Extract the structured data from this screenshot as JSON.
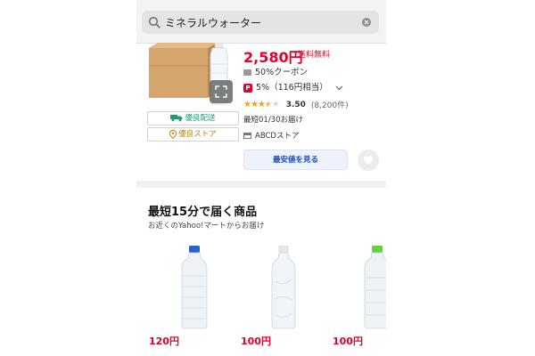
{
  "search": {
    "query": "ミネラルウォーター"
  },
  "product": {
    "price": "2,580円",
    "shipping_note": "送料無料",
    "coupon": "50%クーポン",
    "points": "5%（116円相当）",
    "rating_value": "3.50",
    "review_count": "(8,200件)",
    "rating_stars": 3.5,
    "delivery": "最短01/30お届け",
    "store_name": "ABCDストア",
    "badges": [
      "優良配送",
      "優良ストア"
    ],
    "cheapest_button": "最安値を見る"
  },
  "quick_section": {
    "title": "最短15分で届く商品",
    "subtitle": "お近くのYahoo!マートからお届け",
    "items": [
      {
        "price": "120円",
        "cap_color": "#2a62c9"
      },
      {
        "price": "100円",
        "cap_color": "#e6e6e6"
      },
      {
        "price": "100円",
        "cap_color": "#6ccf3a"
      }
    ]
  },
  "colors": {
    "accent_red": "#e4002b",
    "link_blue": "#1a4bbf",
    "green_badge": "#17a36a",
    "gold_badge": "#b8860b",
    "star": "#f0a020"
  },
  "icons": [
    "search-icon",
    "clear-icon",
    "expand-icon",
    "truck-icon",
    "location-pin-icon",
    "coupon-icon",
    "paypay-points-icon",
    "chevron-down-icon",
    "store-icon",
    "heart-icon"
  ]
}
